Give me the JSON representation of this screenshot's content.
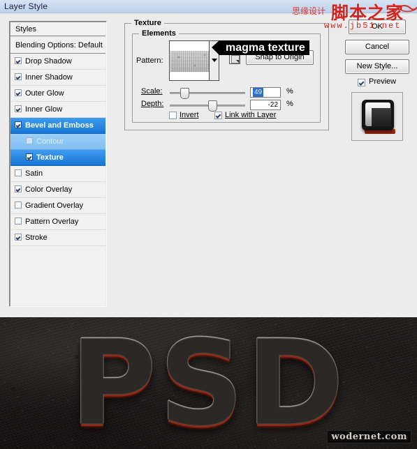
{
  "window": {
    "title": "Layer Style"
  },
  "styles_panel": {
    "header": "Styles",
    "blending_options": "Blending Options: Default",
    "items": [
      {
        "label": "Drop Shadow",
        "checked": true,
        "selected": false,
        "sub": false,
        "disabled": false
      },
      {
        "label": "Inner Shadow",
        "checked": true,
        "selected": false,
        "sub": false,
        "disabled": false
      },
      {
        "label": "Outer Glow",
        "checked": true,
        "selected": false,
        "sub": false,
        "disabled": false
      },
      {
        "label": "Inner Glow",
        "checked": true,
        "selected": false,
        "sub": false,
        "disabled": false
      },
      {
        "label": "Bevel and Emboss",
        "checked": true,
        "selected": true,
        "sub": false,
        "disabled": false
      },
      {
        "label": "Contour",
        "checked": false,
        "selected": false,
        "sub": true,
        "disabled": true
      },
      {
        "label": "Texture",
        "checked": true,
        "selected": true,
        "sub": true,
        "disabled": false
      },
      {
        "label": "Satin",
        "checked": false,
        "selected": false,
        "sub": false,
        "disabled": false
      },
      {
        "label": "Color Overlay",
        "checked": true,
        "selected": false,
        "sub": false,
        "disabled": false
      },
      {
        "label": "Gradient Overlay",
        "checked": false,
        "selected": false,
        "sub": false,
        "disabled": false
      },
      {
        "label": "Pattern Overlay",
        "checked": false,
        "selected": false,
        "sub": false,
        "disabled": false
      },
      {
        "label": "Stroke",
        "checked": true,
        "selected": false,
        "sub": false,
        "disabled": false
      }
    ]
  },
  "texture": {
    "group_title": "Texture",
    "elements_title": "Elements",
    "pattern_label": "Pattern:",
    "pattern_icon": "pattern-swatch-magma",
    "dropdown_icon": "chevron-down-icon",
    "new_pattern_icon": "new-pattern-icon",
    "snap_to_origin": "Snap to Origin",
    "scale_label": "Scale:",
    "scale_value": "49",
    "scale_unit": "%",
    "depth_label": "Depth:",
    "depth_value": "-22",
    "depth_unit": "%",
    "invert_label": "Invert",
    "invert_checked": false,
    "link_label": "Link with Layer",
    "link_checked": true
  },
  "callout": {
    "text": "magma texture",
    "arrow_icon": "arrow-left-icon"
  },
  "buttons": {
    "ok": "OK",
    "cancel": "Cancel",
    "new_style": "New Style...",
    "preview": "Preview",
    "preview_checked": true,
    "preview_thumb_icon": "layer-preview-thumbnail"
  },
  "watermark_top": {
    "chinese_small": "思缘设计",
    "chinese_big": "脚本之家",
    "url": "www.jb51.net",
    "scribble_icon": "red-scribble-mark"
  },
  "canvas": {
    "text": "PSD",
    "watermark": "wodernet.com",
    "background_icon": "dark-concrete-texture"
  },
  "colors": {
    "dialog_bg": "#ececec",
    "titlebar": "#cbdcf0",
    "selection_blue": "#1877d6",
    "selection_blue_disabled": "#7fbef2",
    "watermark_red": "#d2251f",
    "text_face": "#2b2826",
    "text_bevel_light": "#9d9a94",
    "text_glow_red": "#8e2b18",
    "canvas_bg": "#1a1817"
  }
}
